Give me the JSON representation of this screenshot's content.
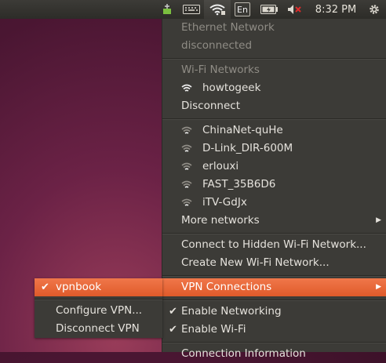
{
  "topbar": {
    "clock": "8:32 PM",
    "lang": "En",
    "icons": [
      "network-wired-icon",
      "keyboard-icon",
      "wifi-icon",
      "keyboard-layout-icon",
      "battery-icon",
      "volume-muted-icon",
      "gear-icon"
    ]
  },
  "menu": {
    "ethernet_header": "Ethernet Network",
    "ethernet_status": "disconnected",
    "wifi_header": "Wi-Fi Networks",
    "connected_network": "howtogeek",
    "disconnect": "Disconnect",
    "networks": [
      "ChinaNet-quHe",
      "D-Link_DIR-600M",
      "erlouxi",
      "FAST_35B6D6",
      "iTV-GdJx"
    ],
    "more_networks": "More networks",
    "connect_hidden": "Connect to Hidden Wi-Fi Network...",
    "create_new": "Create New Wi-Fi Network...",
    "vpn_connections": "VPN Connections",
    "enable_networking": "Enable Networking",
    "enable_wifi": "Enable Wi-Fi",
    "connection_information": "Connection Information"
  },
  "vpn_submenu": {
    "vpnbook": "vpnbook",
    "configure_vpn": "Configure VPN...",
    "disconnect_vpn": "Disconnect VPN"
  },
  "colors": {
    "highlight": "#e8653a",
    "menu_bg": "#3c3b37",
    "panel_bg": "#2f2e2a"
  }
}
